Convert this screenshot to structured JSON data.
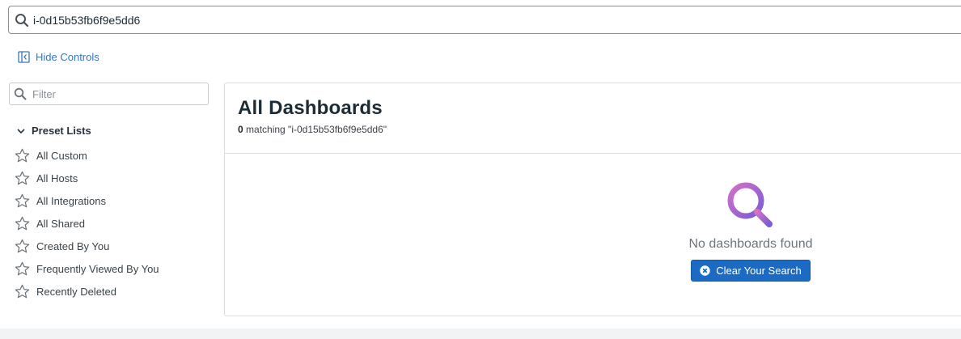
{
  "search": {
    "value": "i-0d15b53fb6f9e5dd6",
    "icon": "search-icon"
  },
  "controls": {
    "hide_label": "Hide Controls",
    "hide_icon": "sidebar-collapse-icon"
  },
  "filter": {
    "placeholder": "Filter",
    "icon": "search-icon"
  },
  "preset_lists": {
    "header": "Preset Lists",
    "items": [
      {
        "label": "All Custom",
        "icon": "star-outline-icon"
      },
      {
        "label": "All Hosts",
        "icon": "star-outline-icon"
      },
      {
        "label": "All Integrations",
        "icon": "star-outline-icon"
      },
      {
        "label": "All Shared",
        "icon": "star-outline-icon"
      },
      {
        "label": "Created By You",
        "icon": "star-outline-icon"
      },
      {
        "label": "Frequently Viewed By You",
        "icon": "star-outline-icon"
      },
      {
        "label": "Recently Deleted",
        "icon": "star-outline-icon"
      }
    ]
  },
  "main": {
    "title": "All Dashboards",
    "match_count": "0",
    "match_text": "matching \"i-0d15b53fb6f9e5dd6\"",
    "empty_icon": "magnifier-gradient-icon",
    "empty_message": "No dashboards found",
    "clear_button": "Clear Your Search",
    "clear_icon": "close-circle-icon"
  },
  "colors": {
    "link": "#3277c6",
    "primary_button": "#1b6bc4",
    "icon_gradient_start": "#c66fc9",
    "icon_gradient_end": "#7f5fd4"
  }
}
